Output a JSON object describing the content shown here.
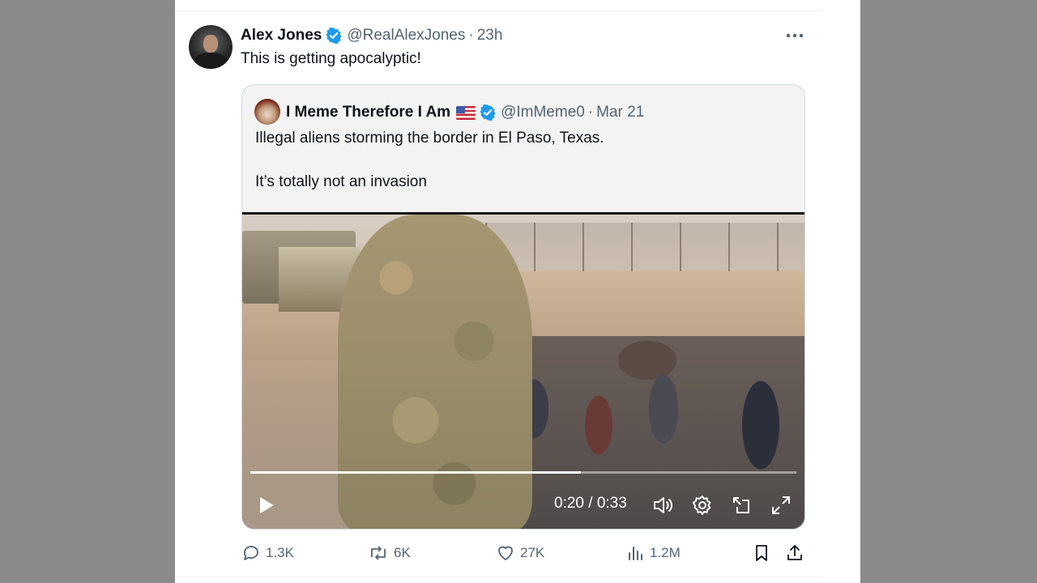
{
  "tweet": {
    "author_name": "Alex Jones",
    "author_handle": "@RealAlexJones",
    "separator": "·",
    "time": "23h",
    "text": "This is getting apocalyptic!"
  },
  "quote": {
    "author_name": "I Meme Therefore I Am",
    "author_handle": "@ImMeme0",
    "separator": "·",
    "date": "Mar 21",
    "text_line1": "Illegal aliens storming the border in El Paso, Texas.",
    "text_line2": "It’s totally not an invasion",
    "video": {
      "current_time": "0:20",
      "duration": "0:33",
      "time_display": "0:20 / 0:33",
      "progress": 0.606
    }
  },
  "actions": {
    "replies": "1.3K",
    "reposts": "6K",
    "likes": "27K",
    "views": "1.2M"
  },
  "colors": {
    "verified": "#1d9bf0",
    "secondary_text": "#536471",
    "primary_text": "#0f1419"
  },
  "icons": [
    "more-icon",
    "verified-icon",
    "flag-us-icon",
    "play-icon",
    "volume-icon",
    "settings-icon",
    "pip-icon",
    "fullscreen-icon",
    "reply-icon",
    "repost-icon",
    "like-icon",
    "views-icon",
    "bookmark-icon",
    "share-icon"
  ]
}
